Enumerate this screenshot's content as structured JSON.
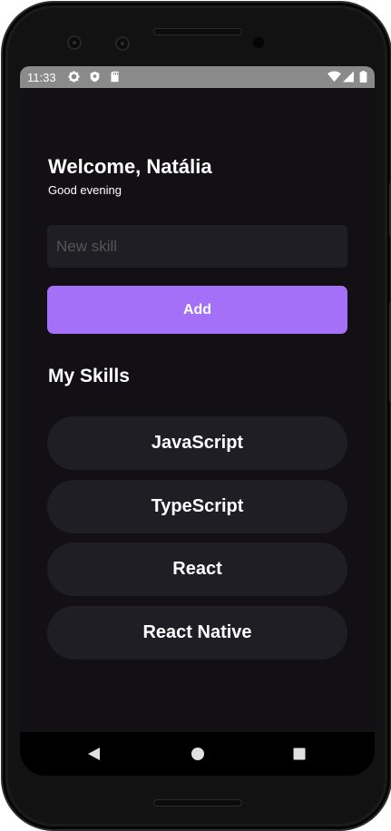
{
  "status_bar": {
    "time": "11:33",
    "icons": [
      "settings-gear-icon",
      "shield-icon",
      "sd-card-icon",
      "wifi-icon",
      "signal-icon",
      "battery-icon"
    ]
  },
  "header": {
    "greeting": "Welcome, Natália",
    "subtitle": "Good evening"
  },
  "form": {
    "input_placeholder": "New skill",
    "input_value": "",
    "add_label": "Add"
  },
  "skills_section": {
    "title": "My Skills",
    "items": [
      {
        "label": "JavaScript"
      },
      {
        "label": "TypeScript"
      },
      {
        "label": "React"
      },
      {
        "label": "React Native"
      }
    ]
  },
  "nav_bar": {
    "icons": [
      "back-icon",
      "home-icon",
      "recents-icon"
    ]
  },
  "colors": {
    "background": "#121015",
    "card": "#1f1e25",
    "accent": "#a370f7",
    "text": "#ffffff",
    "placeholder": "#555555",
    "status_bar": "#8a8a8a"
  }
}
